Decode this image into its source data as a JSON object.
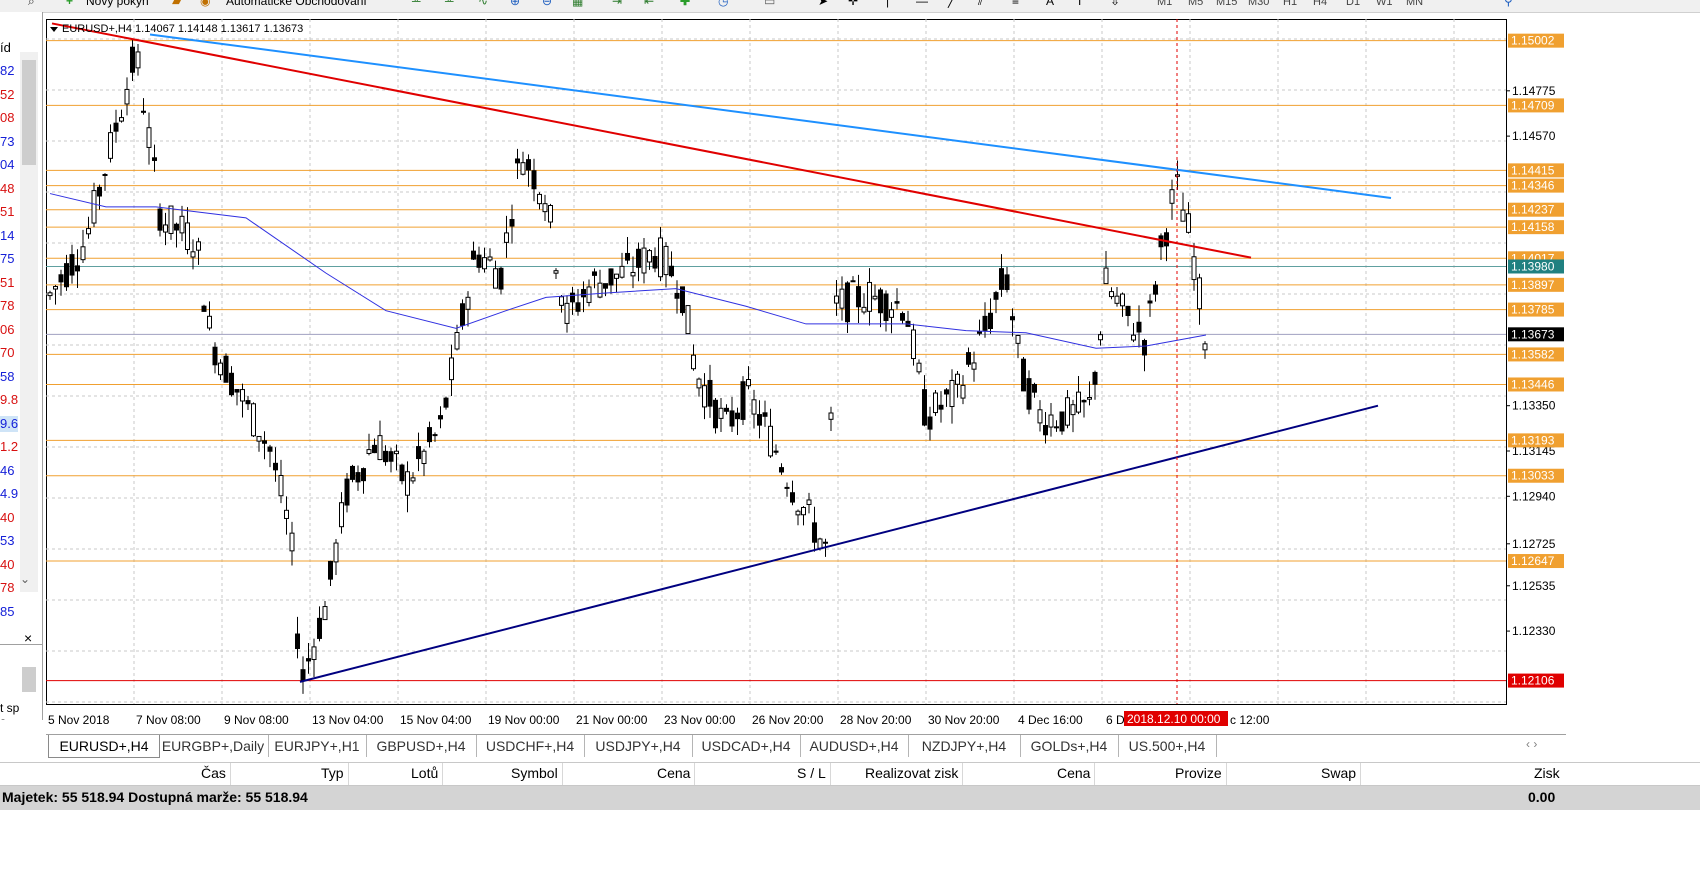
{
  "toolbar": {
    "new_order": "Nový pokyn",
    "auto_trading": "Automatické Obchodování",
    "timeframes": [
      "M1",
      "M5",
      "M15",
      "M30",
      "H1",
      "H4",
      "D1",
      "W1",
      "MN"
    ]
  },
  "left_panel": {
    "header": "íd",
    "values": [
      {
        "text": "82",
        "color": "blue"
      },
      {
        "text": "52",
        "color": "red"
      },
      {
        "text": "08",
        "color": "red"
      },
      {
        "text": "73",
        "color": "blue"
      },
      {
        "text": "04",
        "color": "blue"
      },
      {
        "text": "48",
        "color": "red"
      },
      {
        "text": "51",
        "color": "red"
      },
      {
        "text": "14",
        "color": "blue"
      },
      {
        "text": "75",
        "color": "blue"
      },
      {
        "text": "51",
        "color": "red"
      },
      {
        "text": "78",
        "color": "red"
      },
      {
        "text": "06",
        "color": "red"
      },
      {
        "text": "70",
        "color": "red"
      },
      {
        "text": "58",
        "color": "blue"
      },
      {
        "text": "9.8",
        "color": "red"
      },
      {
        "text": "9.6",
        "color": "blue"
      },
      {
        "text": "1.2",
        "color": "red"
      },
      {
        "text": "46",
        "color": "blue"
      },
      {
        "text": "4.9",
        "color": "blue"
      },
      {
        "text": "40",
        "color": "red"
      },
      {
        "text": "53",
        "color": "blue"
      },
      {
        "text": "40",
        "color": "red"
      },
      {
        "text": "78",
        "color": "red"
      },
      {
        "text": "85",
        "color": "blue"
      }
    ],
    "close": "×",
    "bottom_text_1": "t sp",
    "bottom_text_2": "s"
  },
  "chart": {
    "header": "EURUSD+,H4  1.14067 1.14148 1.13617 1.13673",
    "price_min": 1.12,
    "price_max": 1.151,
    "price_axis_labels": [
      "1.14775",
      "1.14570",
      "1.13350",
      "1.13145",
      "1.12940",
      "1.12725",
      "1.12535",
      "1.12330"
    ],
    "level_lines": [
      {
        "price": 1.15002,
        "label": "1.15002",
        "kind": "orange"
      },
      {
        "price": 1.14709,
        "label": "1.14709",
        "kind": "orange"
      },
      {
        "price": 1.14415,
        "label": "1.14415",
        "kind": "orange"
      },
      {
        "price": 1.14346,
        "label": "1.14346",
        "kind": "orange"
      },
      {
        "price": 1.14237,
        "label": "1.14237",
        "kind": "orange"
      },
      {
        "price": 1.14158,
        "label": "1.14158",
        "kind": "orange"
      },
      {
        "price": 1.14017,
        "label": "1.14017",
        "kind": "orange"
      },
      {
        "price": 1.13897,
        "label": "1.13897",
        "kind": "orange"
      },
      {
        "price": 1.13785,
        "label": "1.13785",
        "kind": "orange"
      },
      {
        "price": 1.13582,
        "label": "1.13582",
        "kind": "orange"
      },
      {
        "price": 1.13446,
        "label": "1.13446",
        "kind": "orange"
      },
      {
        "price": 1.13193,
        "label": "1.13193",
        "kind": "orange"
      },
      {
        "price": 1.13033,
        "label": "1.13033",
        "kind": "orange"
      },
      {
        "price": 1.12647,
        "label": "1.12647",
        "kind": "orange"
      },
      {
        "price": 1.12106,
        "label": "1.12106",
        "kind": "red"
      }
    ],
    "bid_price": {
      "price": 1.1398,
      "label": "1.13980"
    },
    "current_price": {
      "price": 1.13673,
      "label": "1.13673"
    },
    "time_labels": [
      "5 Nov 2018",
      "7 Nov 08:00",
      "9 Nov 08:00",
      "13 Nov 04:00",
      "15 Nov 04:00",
      "19 Nov 00:00",
      "21 Nov 00:00",
      "23 Nov 00:00",
      "26 Nov 20:00",
      "28 Nov 20:00",
      "30 Nov 20:00",
      "4 Dec 16:00",
      "6 D"
    ],
    "cursor_time": "2018.12.10 00:00",
    "cursor_time_suffix": "c 12:00",
    "colors": {
      "orange": "#f0a030",
      "red": "#e00000",
      "blue_trend": "#1e90ff",
      "navy_trend": "#000080",
      "ma": "#3030e0",
      "bid": "#208080"
    }
  },
  "tabs": [
    "EURUSD+,H4",
    "EURGBP+,Daily",
    "EURJPY+,H1",
    "GBPUSD+,H4",
    "USDCHF+,H4",
    "USDJPY+,H4",
    "USDCAD+,H4",
    "AUDUSD+,H4",
    "NZDJPY+,H4",
    "GOLDs+,H4",
    "US.500+,H4"
  ],
  "trade_columns": [
    "Čas",
    "Typ",
    "Lotů",
    "Symbol",
    "Cena",
    "S / L",
    "Realizovat zisk",
    "Cena",
    "Provize",
    "Swap",
    "Zisk"
  ],
  "balance": {
    "text": "Majetek: 55 518.94  Dostupná marže: 55 518.94",
    "right": "0.00"
  }
}
